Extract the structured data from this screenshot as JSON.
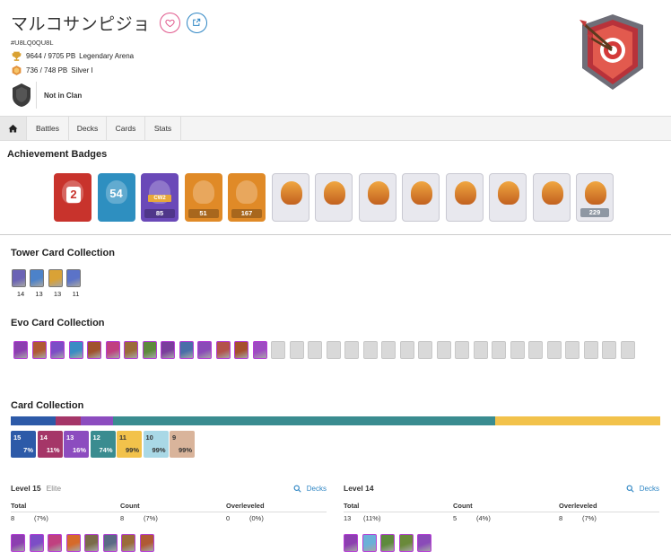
{
  "profile": {
    "name": "マルコサンピジョ",
    "tag": "#U8LQ0QU8L",
    "trophies": "9644 / 9705 PB",
    "arena": "Legendary Arena",
    "ranked": "736 / 748 PB",
    "league": "Silver I",
    "clan": "Not in Clan"
  },
  "nav": {
    "items": [
      "Battles",
      "Decks",
      "Cards",
      "Stats"
    ]
  },
  "achievements": {
    "title": "Achievement Badges",
    "badges": [
      {
        "icon": "years-played-badge",
        "label": "2",
        "bg": "#c8332c",
        "label_pos": "center"
      },
      {
        "icon": "level-badge",
        "label": "54",
        "bg": "#2e8fc0",
        "label_pos": "center"
      },
      {
        "icon": "clan-wars-badge",
        "label": "85",
        "bg": "#6a49b8",
        "label_pos": "bottom",
        "top_text": "CW2"
      },
      {
        "icon": "cards-collected-badge",
        "label": "51",
        "bg": "#e08a27",
        "label_pos": "bottom"
      },
      {
        "icon": "crown-badge",
        "label": "167",
        "bg": "#e08a27",
        "label_pos": "bottom"
      },
      {
        "icon": "tournament-badge-1",
        "label": "",
        "bg": "#e8e8ee",
        "label_pos": "none"
      },
      {
        "icon": "tournament-badge-2",
        "label": "",
        "bg": "#e8e8ee",
        "label_pos": "none"
      },
      {
        "icon": "tournament-badge-3",
        "label": "",
        "bg": "#e8e8ee",
        "label_pos": "none"
      },
      {
        "icon": "tournament-badge-4",
        "label": "",
        "bg": "#e8e8ee",
        "label_pos": "none"
      },
      {
        "icon": "tournament-badge-5",
        "label": "",
        "bg": "#e8e8ee",
        "label_pos": "none"
      },
      {
        "icon": "tournament-badge-6",
        "label": "",
        "bg": "#e8e8ee",
        "label_pos": "none"
      },
      {
        "icon": "tournament-badge-7",
        "label": "",
        "bg": "#e8e8ee",
        "label_pos": "none"
      },
      {
        "icon": "emote-collection-badge",
        "label": "229",
        "bg": "#e8e8ee",
        "label_pos": "bottom"
      }
    ]
  },
  "tower_collection": {
    "title": "Tower Card Collection",
    "towers": [
      {
        "level": "14",
        "color": "#6b63b5"
      },
      {
        "level": "13",
        "color": "#4c82c9"
      },
      {
        "level": "13",
        "color": "#d9a236"
      },
      {
        "level": "11",
        "color": "#5b73c8"
      }
    ]
  },
  "evo_collection": {
    "title": "Evo Card Collection",
    "owned_colors": [
      "#8c3fb0",
      "#b05a35",
      "#7c4dc6",
      "#3a8cc4",
      "#a0522d",
      "#c04080",
      "#9b6b3a",
      "#5e8a3d",
      "#7a3c9c",
      "#4a6ea8",
      "#8a4bb8",
      "#b3534a",
      "#a64f2e",
      "#9e4bc2"
    ],
    "unowned_count": 20
  },
  "card_collection": {
    "title": "Card Collection",
    "bar": [
      {
        "color": "#2d5aa8",
        "weight": 50
      },
      {
        "color": "#a53668",
        "weight": 28
      },
      {
        "color": "#8c4cbf",
        "weight": 36
      },
      {
        "color": "#3a8c90",
        "weight": 425
      },
      {
        "color": "#f2c24b",
        "weight": 183
      }
    ],
    "levels": [
      {
        "level": "15",
        "pct": "7%",
        "bg": "#2d5aa8"
      },
      {
        "level": "14",
        "pct": "11%",
        "bg": "#a53668"
      },
      {
        "level": "13",
        "pct": "16%",
        "bg": "#8c4cbf"
      },
      {
        "level": "12",
        "pct": "74%",
        "bg": "#3a8c90"
      },
      {
        "level": "11",
        "pct": "99%",
        "bg": "#f2c24b"
      },
      {
        "level": "10",
        "pct": "99%",
        "bg": "#a9d8e6"
      },
      {
        "level": "9",
        "pct": "99%",
        "bg": "#d9b49b"
      }
    ]
  },
  "level_panels": [
    {
      "title": "Level 15",
      "sub": "Elite",
      "decks_label": "Decks",
      "cols": [
        "Total",
        "Count",
        "Overleveled"
      ],
      "total": "8",
      "total_pct": "(7%)",
      "count": "8",
      "count_pct": "(7%)",
      "over": "0",
      "over_pct": "(0%)",
      "cards": [
        "#8c3fb0",
        "#7c4dc6",
        "#c04080",
        "#d66a2a",
        "#7a6b4a",
        "#5a6a85",
        "#9b6b3a",
        "#b05a35"
      ]
    },
    {
      "title": "Level 14",
      "sub": "",
      "decks_label": "Decks",
      "cols": [
        "Total",
        "Count",
        "Overleveled"
      ],
      "total": "13",
      "total_pct": "(11%)",
      "count": "5",
      "count_pct": "(4%)",
      "over": "8",
      "over_pct": "(7%)",
      "cards": [
        "#8c3fb0",
        "#6bb0d8",
        "#5e8a3d",
        "#6a8a3a",
        "#8a4bb8"
      ]
    }
  ]
}
